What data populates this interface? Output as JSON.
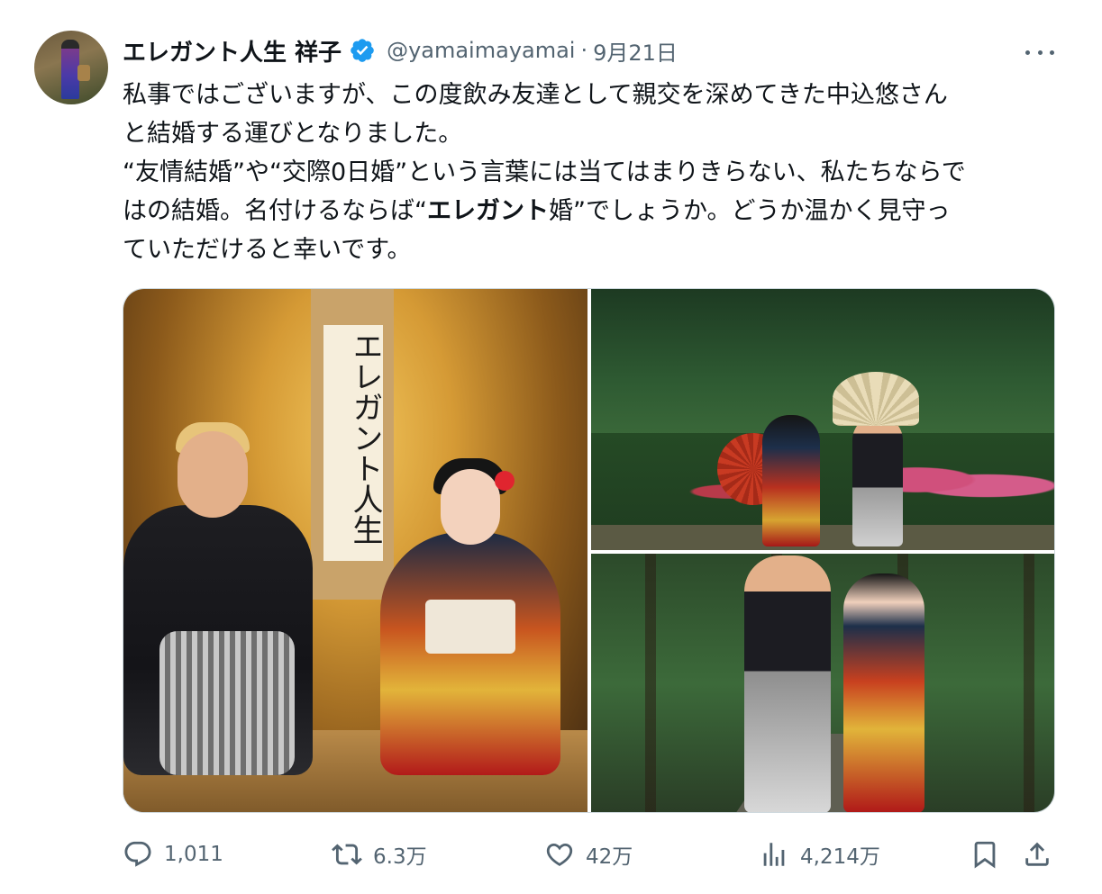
{
  "author": {
    "display_name": "エレガント人生 祥子",
    "handle": "@yamaimayamai",
    "separator": "·",
    "date": "9月21日",
    "verified": true
  },
  "body": {
    "line1": "私事ではございますが、この度飲み友達として親交を深めてきた中込悠さん",
    "line2": "と結婚する運びとなりました。",
    "line3": "“友情結婚”や“交際0日婚”という言葉には当てはまりきらない、私たちならで",
    "line4_pre": "はの結婚。名付けるならば“",
    "line4_bold": "エレガント",
    "line4_post": "婚”でしょうか。どうか温かく見守っ",
    "line5": "ていただけると幸いです。"
  },
  "media": {
    "scroll_text": "エレガント人生"
  },
  "actions": {
    "replies": "1,011",
    "retweets": "6.3万",
    "likes": "42万",
    "views": "4,214万"
  },
  "icons": {
    "verified": "verified-badge-icon",
    "more": "more-icon",
    "reply": "reply-icon",
    "retweet": "retweet-icon",
    "like": "heart-icon",
    "views": "views-icon",
    "bookmark": "bookmark-icon",
    "share": "share-icon"
  },
  "colors": {
    "verified": "#1d9bf0",
    "text": "#0f1419",
    "secondary": "#536471"
  }
}
